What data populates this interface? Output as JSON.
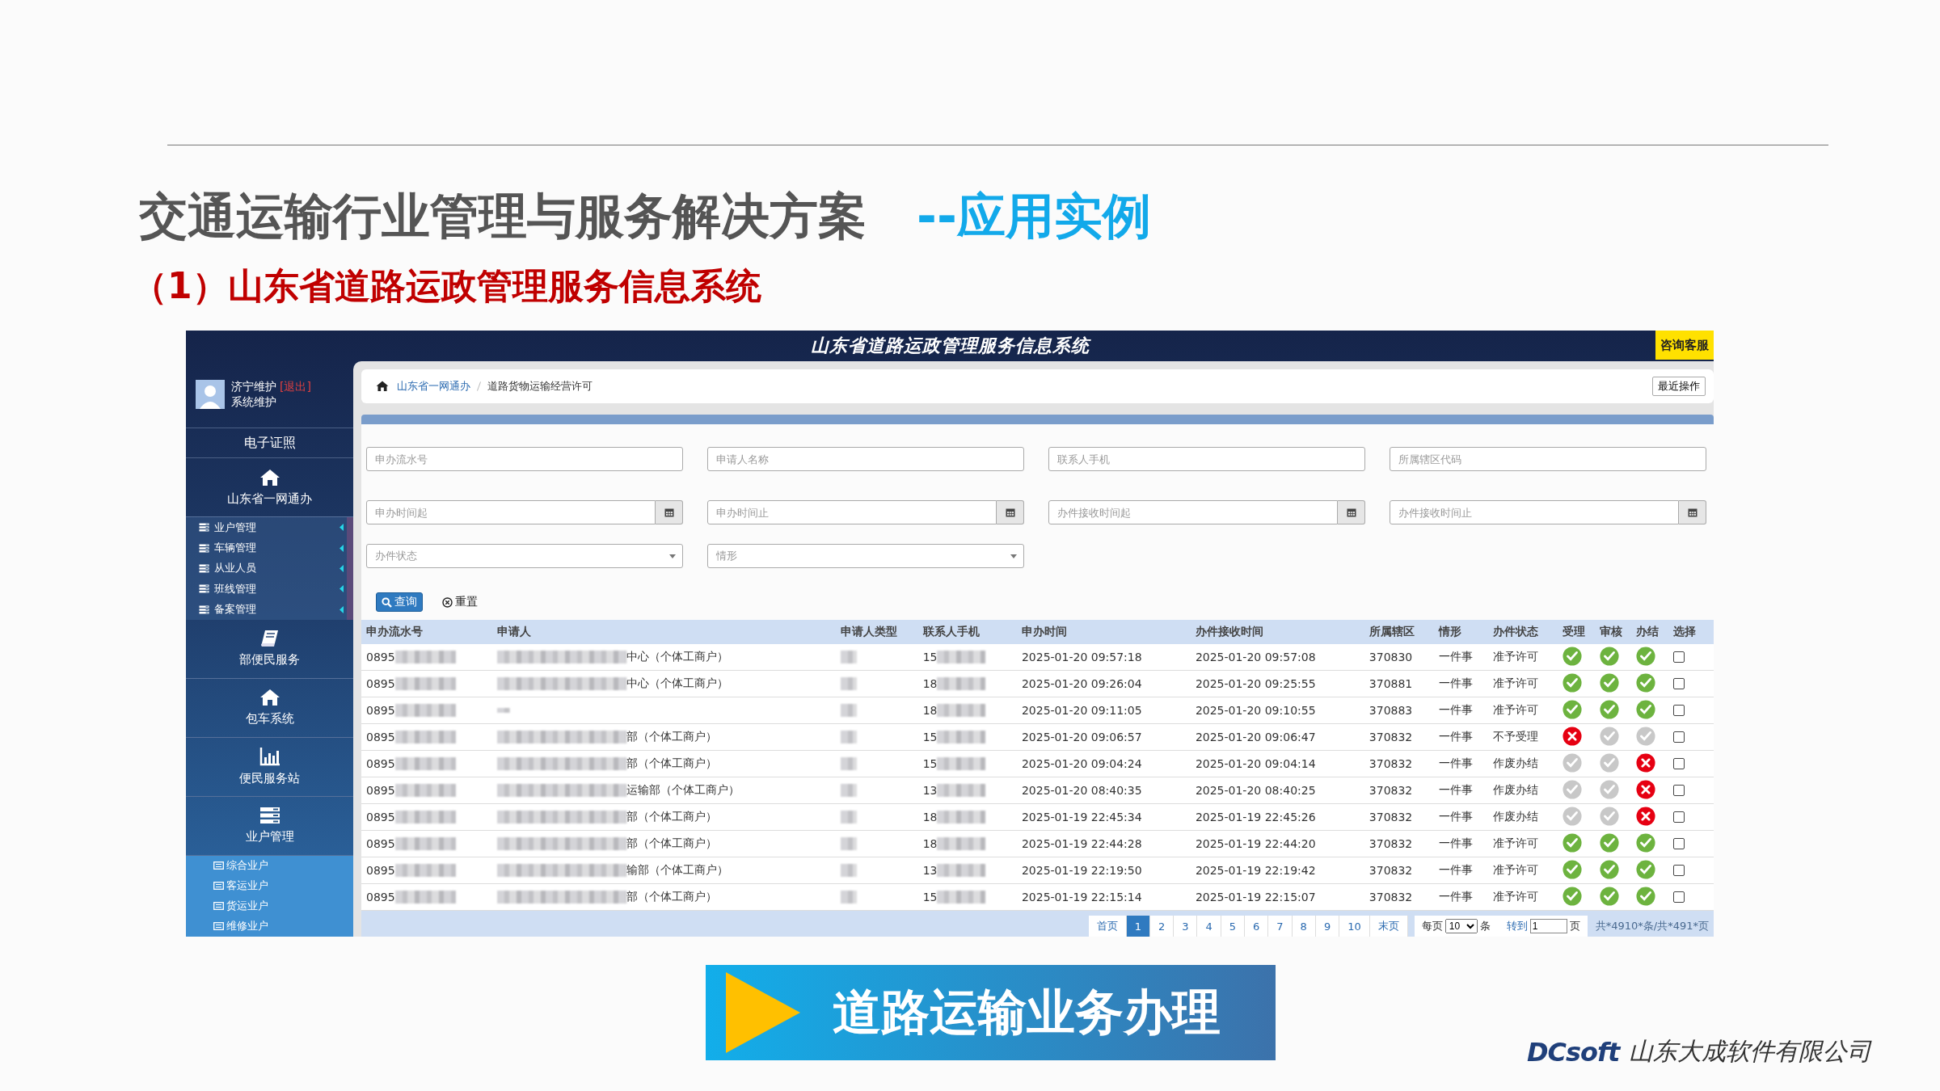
{
  "slide": {
    "title": "交通运输行业管理与服务解决方案",
    "title_suffix": "--应用实例",
    "subtitle": "（1）山东省道路运政管理服务信息系统",
    "banner": "道路运输业务办理",
    "logo": "DCsoft",
    "company": "山东大成软件有限公司"
  },
  "app": {
    "header_title": "山东省道路运政管理服务信息系统",
    "help_button": "咨询客服",
    "user": {
      "name": "济宁维护",
      "logout": "[退出]",
      "role": "系统维护"
    },
    "sidebar": [
      {
        "label": "电子证照"
      },
      {
        "label": "山东省一网通办",
        "children": [
          {
            "label": "业户管理"
          },
          {
            "label": "车辆管理"
          },
          {
            "label": "从业人员"
          },
          {
            "label": "班线管理"
          },
          {
            "label": "备案管理"
          }
        ]
      },
      {
        "label": "部便民服务"
      },
      {
        "label": "包车系统"
      },
      {
        "label": "便民服务站"
      },
      {
        "label": "业户管理",
        "children": [
          {
            "label": "综合业户"
          },
          {
            "label": "客运业户"
          },
          {
            "label": "货运业户"
          },
          {
            "label": "维修业户"
          }
        ]
      }
    ],
    "breadcrumb": [
      {
        "label": "山东省一网通办"
      },
      {
        "label": "道路货物运输经营许可"
      }
    ],
    "recent_button": "最近操作",
    "filters": [
      {
        "kind": "text",
        "placeholder": "申办流水号"
      },
      {
        "kind": "text",
        "placeholder": "申请人名称"
      },
      {
        "kind": "text",
        "placeholder": "联系人手机"
      },
      {
        "kind": "text",
        "placeholder": "所属辖区代码"
      },
      {
        "kind": "date",
        "placeholder": "申办时间起"
      },
      {
        "kind": "date",
        "placeholder": "申办时间止"
      },
      {
        "kind": "date",
        "placeholder": "办件接收时间起"
      },
      {
        "kind": "date",
        "placeholder": "办件接收时间止"
      },
      {
        "kind": "select",
        "placeholder": "办件状态"
      },
      {
        "kind": "select",
        "placeholder": "情形"
      }
    ],
    "search_button": "查询",
    "reset_button": "重置",
    "table": {
      "columns": [
        "申办流水号",
        "申请人",
        "申请人类型",
        "联系人手机",
        "申办时间",
        "办件接收时间",
        "所属辖区",
        "情形",
        "办件状态",
        "受理",
        "审核",
        "办结",
        "选择"
      ],
      "rows": [
        {
          "serial": "0895",
          "applicant": "中心（个体工商户）",
          "phone": "15",
          "applied": "2025-01-20 09:57:18",
          "received": "2025-01-20 09:57:08",
          "area": "370830",
          "case": "一件事",
          "status": "准予许可",
          "steps": [
            {
              "passed": true,
              "rejected": false
            },
            {
              "passed": true,
              "rejected": false
            },
            {
              "passed": true,
              "rejected": false
            }
          ],
          "selected": false
        },
        {
          "serial": "0895",
          "applicant": "中心（个体工商户）",
          "phone": "18",
          "applied": "2025-01-20 09:26:04",
          "received": "2025-01-20 09:25:55",
          "area": "370881",
          "case": "一件事",
          "status": "准予许可",
          "steps": [
            {
              "passed": true,
              "rejected": false
            },
            {
              "passed": true,
              "rejected": false
            },
            {
              "passed": true,
              "rejected": false
            }
          ],
          "selected": false
        },
        {
          "serial": "0895",
          "phone": "18",
          "applied": "2025-01-20 09:11:05",
          "received": "2025-01-20 09:10:55",
          "area": "370883",
          "case": "一件事",
          "status": "准予许可",
          "steps": [
            {
              "passed": true,
              "rejected": false
            },
            {
              "passed": true,
              "rejected": false
            },
            {
              "passed": true,
              "rejected": false
            }
          ],
          "selected": false
        },
        {
          "serial": "0895",
          "applicant": "部（个体工商户）",
          "phone": "15",
          "applied": "2025-01-20 09:06:57",
          "received": "2025-01-20 09:06:47",
          "area": "370832",
          "case": "一件事",
          "status": "不予受理",
          "steps": [
            {
              "rejected": true
            },
            {
              "passed": false,
              "rejected": false
            },
            {
              "passed": false,
              "rejected": false
            }
          ],
          "selected": false
        },
        {
          "serial": "0895",
          "applicant": "部（个体工商户）",
          "phone": "15",
          "applied": "2025-01-20 09:04:24",
          "received": "2025-01-20 09:04:14",
          "area": "370832",
          "case": "一件事",
          "status": "作废办结",
          "steps": [
            {
              "passed": false,
              "rejected": false
            },
            {
              "passed": false,
              "rejected": false
            },
            {
              "rejected": true
            }
          ],
          "selected": false
        },
        {
          "serial": "0895",
          "applicant": "运输部（个体工商户）",
          "phone": "13",
          "applied": "2025-01-20 08:40:35",
          "received": "2025-01-20 08:40:25",
          "area": "370832",
          "case": "一件事",
          "status": "作废办结",
          "steps": [
            {
              "passed": false,
              "rejected": false
            },
            {
              "passed": false,
              "rejected": false
            },
            {
              "rejected": true
            }
          ],
          "selected": false
        },
        {
          "serial": "0895",
          "applicant": "部（个体工商户）",
          "phone": "18",
          "applied": "2025-01-19 22:45:34",
          "received": "2025-01-19 22:45:26",
          "area": "370832",
          "case": "一件事",
          "status": "作废办结",
          "steps": [
            {
              "passed": false,
              "rejected": false
            },
            {
              "passed": false,
              "rejected": false
            },
            {
              "rejected": true
            }
          ],
          "selected": false
        },
        {
          "serial": "0895",
          "applicant": "部（个体工商户）",
          "phone": "18",
          "applied": "2025-01-19 22:44:28",
          "received": "2025-01-19 22:44:20",
          "area": "370832",
          "case": "一件事",
          "status": "准予许可",
          "steps": [
            {
              "passed": true,
              "rejected": false
            },
            {
              "passed": true,
              "rejected": false
            },
            {
              "passed": true,
              "rejected": false
            }
          ],
          "selected": false
        },
        {
          "serial": "0895",
          "applicant": "输部（个体工商户）",
          "phone": "13",
          "applied": "2025-01-19 22:19:50",
          "received": "2025-01-19 22:19:42",
          "area": "370832",
          "case": "一件事",
          "status": "准予许可",
          "steps": [
            {
              "passed": true,
              "rejected": false
            },
            {
              "passed": true,
              "rejected": false
            },
            {
              "passed": true,
              "rejected": false
            }
          ],
          "selected": false
        },
        {
          "serial": "0895",
          "applicant": "部（个体工商户）",
          "phone": "15",
          "applied": "2025-01-19 22:15:14",
          "received": "2025-01-19 22:15:07",
          "area": "370832",
          "case": "一件事",
          "status": "准予许可",
          "steps": [
            {
              "passed": true,
              "rejected": false
            },
            {
              "passed": true,
              "rejected": false
            },
            {
              "passed": true,
              "rejected": false
            }
          ],
          "selected": false
        }
      ]
    },
    "pagination": {
      "first": "首页",
      "pages": [
        {
          "label": "1",
          "selected": true
        },
        {
          "label": "2",
          "selected": false
        },
        {
          "label": "3",
          "selected": false
        },
        {
          "label": "4",
          "selected": false
        },
        {
          "label": "5",
          "selected": false
        },
        {
          "label": "6",
          "selected": false
        },
        {
          "label": "7",
          "selected": false
        },
        {
          "label": "8",
          "selected": false
        },
        {
          "label": "9",
          "selected": false
        },
        {
          "label": "10",
          "selected": false
        }
      ],
      "last": "末页",
      "per_page_label": "每页",
      "per_page": "10",
      "per_page_unit": "条",
      "goto_label": "转到",
      "goto_value": "1",
      "goto_unit": "页",
      "total": "共*4910*条/共*491*页"
    }
  }
}
